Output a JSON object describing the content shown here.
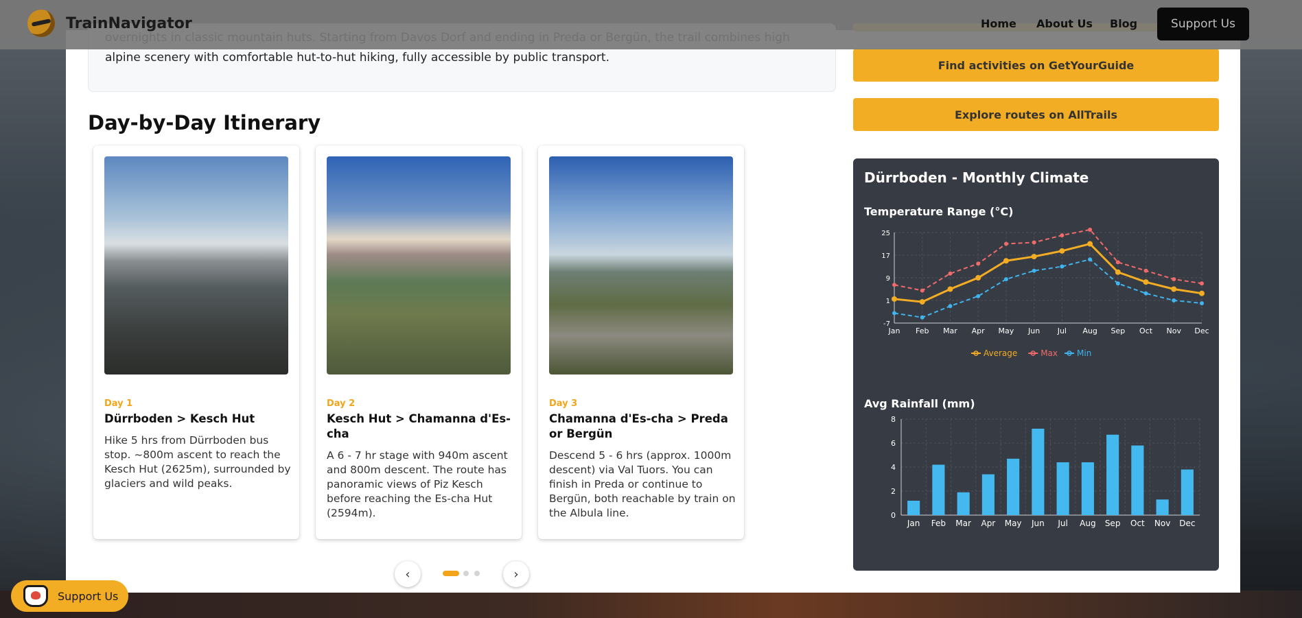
{
  "header": {
    "brand": "TrainNavigator",
    "nav": [
      "Home",
      "About Us",
      "Blog"
    ],
    "support_label": "Support Us"
  },
  "intro": {
    "text": "overnights in classic mountain huts. Starting from Davos Dorf and ending in Preda or Bergün, the trail combines high alpine scenery with comfortable hut-to-hut hiking, fully accessible by public transport."
  },
  "itinerary": {
    "title": "Day-by-Day Itinerary",
    "cards": [
      {
        "day": "Day 1",
        "title": "Dürrboden > Kesch Hut",
        "desc": "Hike 5 hrs from Dürrboden bus stop. ~800m ascent to reach the Kesch Hut (2625m), surrounded by glaciers and wild peaks."
      },
      {
        "day": "Day 2",
        "title": "Kesch Hut > Chamanna d'Es-cha",
        "desc": "A 6 - 7 hr stage with 940m ascent and 800m descent. The route has panoramic views of Piz Kesch before reaching the Es-cha Hut (2594m)."
      },
      {
        "day": "Day 3",
        "title": "Chamanna d'Es-cha > Preda or Bergün",
        "desc": "Descend 5 - 6 hrs (approx. 1000m descent) via Val Tuors. You can finish in Preda or continue to Bergün, both reachable by train on the Albula line."
      }
    ],
    "carousel": {
      "prev": "‹",
      "next": "›",
      "pages": 3,
      "active": 1
    }
  },
  "sidebar": {
    "cta_1": "Find activities on GetYourGuide",
    "cta_2": "Explore routes on AllTrails"
  },
  "climate": {
    "title": "Dürrboden - Monthly Climate",
    "temp_title": "Temperature Range (°C)",
    "rain_title": "Avg Rainfall (mm)"
  },
  "bmc": {
    "label": "Support Us"
  },
  "colors": {
    "accent": "#f3ad24",
    "avg": "#f3ad24",
    "max": "#f26b6b",
    "min": "#3fb4ee",
    "bar": "#43b9f0",
    "panel_dark": "#373b44"
  },
  "chart_data": [
    {
      "type": "line",
      "title": "Temperature Range (°C)",
      "categories": [
        "Jan",
        "Feb",
        "Mar",
        "Apr",
        "May",
        "Jun",
        "Jul",
        "Aug",
        "Sep",
        "Oct",
        "Nov",
        "Dec"
      ],
      "series": [
        {
          "name": "Average",
          "values": [
            1.5,
            0.5,
            5,
            9,
            15,
            16.5,
            18.5,
            21,
            11,
            7.5,
            5,
            3.5
          ]
        },
        {
          "name": "Max",
          "values": [
            6.5,
            4.5,
            10.5,
            14,
            21,
            21.5,
            24,
            26,
            14.5,
            11.5,
            8.5,
            7
          ]
        },
        {
          "name": "Min",
          "values": [
            -3.5,
            -5,
            -1,
            2.5,
            8.5,
            11.5,
            13,
            15.5,
            7,
            3.5,
            1,
            0
          ]
        }
      ],
      "yticks": [
        -7,
        1,
        9,
        17,
        25
      ],
      "ylim": [
        -7,
        25
      ],
      "legend": "bottom-center",
      "grid": true
    },
    {
      "type": "bar",
      "title": "Avg Rainfall (mm)",
      "categories": [
        "Jan",
        "Feb",
        "Mar",
        "Apr",
        "May",
        "Jun",
        "Jul",
        "Aug",
        "Sep",
        "Oct",
        "Nov",
        "Dec"
      ],
      "values": [
        1.2,
        4.2,
        1.9,
        3.4,
        4.7,
        7.2,
        4.4,
        4.4,
        6.7,
        5.8,
        1.3,
        3.8
      ],
      "yticks": [
        0,
        2,
        4,
        6,
        8
      ],
      "ylim": [
        0,
        8
      ],
      "grid": true
    }
  ]
}
